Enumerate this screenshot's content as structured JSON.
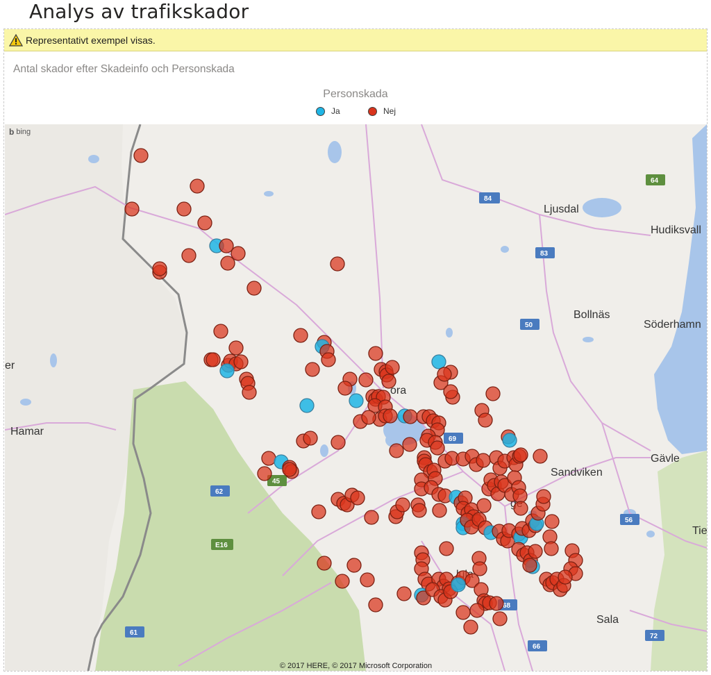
{
  "page_title": "Analys av trafikskador",
  "warning": {
    "text": "Representativt exempel visas.",
    "icon": "warning-triangle-icon",
    "color": "#faf6a8"
  },
  "visual": {
    "title": "Antal skador efter Skadeinfo och Personskada",
    "legend": {
      "title": "Personskada",
      "items": [
        {
          "label": "Ja",
          "color": "#1fb5e5"
        },
        {
          "label": "Nej",
          "color": "#d9341c"
        }
      ]
    }
  },
  "map": {
    "provider": "bing",
    "copyright": "© 2017 HERE, © 2017 Microsoft Corporation",
    "place_labels": [
      "Ljusdal",
      "Hudiksvall",
      "Bollnäs",
      "Söderhamn",
      "Sandviken",
      "Gävle",
      "Sala",
      "Hamar",
      "Tie",
      "er",
      "ora",
      "ge",
      "lula"
    ],
    "road_shields": [
      "64",
      "84",
      "83",
      "50",
      "69",
      "45",
      "62",
      "E16",
      "56",
      "68",
      "61",
      "66",
      "72"
    ],
    "colors": {
      "land": "#f0eeea",
      "water": "#a8c5ea",
      "forest": "#c9dcae",
      "roads": "#d9a9d9"
    }
  }
}
